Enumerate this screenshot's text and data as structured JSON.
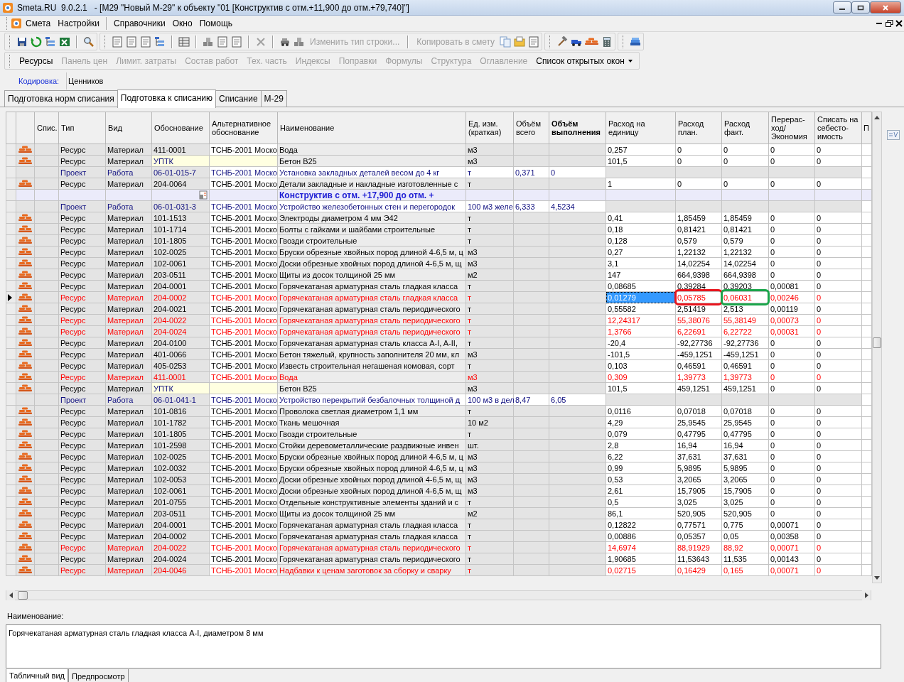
{
  "window": {
    "title": "Smeta.RU  9.0.2.1   - [M29 \"Новый M-29\" к объекту \"01 [Конструктив с отм.+11,900 до отм.+79,740]\"]"
  },
  "menu_groups": [
    [
      "Смета",
      "Настройки"
    ],
    [
      "Справочники",
      "Окно",
      "Помощь"
    ]
  ],
  "toolbar": {
    "buttons": [
      {
        "label": "Изменить тип строки...",
        "disabled": true
      },
      {
        "label": "Копировать в смету",
        "disabled": true
      }
    ]
  },
  "nav_toolbar": [
    {
      "label": "Ресурсы",
      "disabled": false
    },
    {
      "label": "Панель цен",
      "disabled": true
    },
    {
      "label": "Лимит. затраты",
      "disabled": true
    },
    {
      "label": "Состав работ",
      "disabled": true
    },
    {
      "label": "Тех. часть",
      "disabled": true
    },
    {
      "label": "Индексы",
      "disabled": true
    },
    {
      "label": "Поправки",
      "disabled": true
    },
    {
      "label": "Формулы",
      "disabled": true
    },
    {
      "label": "Структура",
      "disabled": true
    },
    {
      "label": "Оглавление",
      "disabled": true
    },
    {
      "label": "Список открытых окон",
      "disabled": false,
      "dropdown": true
    }
  ],
  "coding": {
    "label": "Кодировка:",
    "value": "Ценников"
  },
  "tabs": [
    {
      "label": "Подготовка норм списания",
      "selected": false
    },
    {
      "label": "Подготовка к списанию",
      "selected": true
    },
    {
      "label": "Списание",
      "selected": false
    },
    {
      "label": "М-29",
      "selected": false
    }
  ],
  "table": {
    "columns": [
      {
        "label": "Спис.",
        "bold": false
      },
      {
        "label": "Тип",
        "bold": false
      },
      {
        "label": "Вид",
        "bold": false
      },
      {
        "label": "Обоснование",
        "bold": false
      },
      {
        "label": "Альтернативное обоснование",
        "bold": false
      },
      {
        "label": "Наименование",
        "bold": false
      },
      {
        "label": "Ед. изм. (краткая)",
        "bold": false
      },
      {
        "label": "Объём всего",
        "bold": false
      },
      {
        "label": "Объём выполнения",
        "bold": true
      },
      {
        "label": "Расход на единицу",
        "bold": false
      },
      {
        "label": "Расход план.",
        "bold": false
      },
      {
        "label": "Расход факт.",
        "bold": false
      },
      {
        "label": "Перерас-ход/ Экономия",
        "bold": false
      },
      {
        "label": "Списать на себесто-имость",
        "bold": false
      },
      {
        "label": "П",
        "bold": false
      }
    ],
    "rows": [
      {
        "kind": "resource",
        "warning": false,
        "selected": false,
        "type": "Ресурс",
        "view": "Материал",
        "code": "411-0001",
        "alt": "ТСНБ-2001 Моско",
        "name": "Вода",
        "unit": "м3",
        "per_unit": "0,257",
        "plan": "0",
        "fact": "0",
        "overrun": "0",
        "write_off": "0"
      },
      {
        "kind": "aggregate",
        "warning": false,
        "selected": false,
        "type": "Ресурс",
        "view": "Материал",
        "code": "УПТК",
        "name": "Бетон B25",
        "unit": "м3",
        "per_unit": "101,5",
        "plan": "0",
        "fact": "0",
        "overrun": "0",
        "write_off": "0"
      },
      {
        "kind": "work",
        "warning": false,
        "selected": false,
        "type": "Проект",
        "view": "Работа",
        "code": "06-01-015-7",
        "alt": "ТСНБ-2001 Моско",
        "name": "Установка закладных деталей весом до 4 кг",
        "unit": "т",
        "vol_total": "0,371",
        "vol_done": "0"
      },
      {
        "kind": "resource",
        "warning": false,
        "selected": false,
        "type": "Ресурс",
        "view": "Материал",
        "code": "204-0064",
        "alt": "ТСНБ-2001 Моско",
        "name": "Детали закладные и накладные изготовленные с",
        "unit": "т",
        "per_unit": "1",
        "plan": "0",
        "fact": "0",
        "overrun": "0",
        "write_off": "0"
      },
      {
        "kind": "section",
        "warning": false,
        "selected": false,
        "name": "Конструктив с отм. +17,900 до отм. +"
      },
      {
        "kind": "work",
        "warning": false,
        "selected": false,
        "type": "Проект",
        "view": "Работа",
        "code": "06-01-031-3",
        "alt": "ТСНБ-2001 Моско",
        "name": "Устройство железобетонных стен и перегородок",
        "unit": "100 м3 желе",
        "vol_total": "6,333",
        "vol_done": "4,5234"
      },
      {
        "kind": "resource",
        "warning": false,
        "selected": false,
        "type": "Ресурс",
        "view": "Материал",
        "code": "101-1513",
        "alt": "ТСНБ-2001 Моско",
        "name": "Электроды диаметром 4 мм Э42",
        "unit": "т",
        "per_unit": "0,41",
        "plan": "1,85459",
        "fact": "1,85459",
        "overrun": "0",
        "write_off": "0"
      },
      {
        "kind": "resource",
        "warning": false,
        "selected": false,
        "type": "Ресурс",
        "view": "Материал",
        "code": "101-1714",
        "alt": "ТСНБ-2001 Моско",
        "name": "Болты с гайками и шайбами строительные",
        "unit": "т",
        "per_unit": "0,18",
        "plan": "0,81421",
        "fact": "0,81421",
        "overrun": "0",
        "write_off": "0"
      },
      {
        "kind": "resource",
        "warning": false,
        "selected": false,
        "type": "Ресурс",
        "view": "Материал",
        "code": "101-1805",
        "alt": "ТСНБ-2001 Моско",
        "name": "Гвозди строительные",
        "unit": "т",
        "per_unit": "0,128",
        "plan": "0,579",
        "fact": "0,579",
        "overrun": "0",
        "write_off": "0"
      },
      {
        "kind": "resource",
        "warning": false,
        "selected": false,
        "type": "Ресурс",
        "view": "Материал",
        "code": "102-0025",
        "alt": "ТСНБ-2001 Моско",
        "name": "Бруски обрезные хвойных пород длиной 4-6,5 м, ц",
        "unit": "м3",
        "per_unit": "0,27",
        "plan": "1,22132",
        "fact": "1,22132",
        "overrun": "0",
        "write_off": "0"
      },
      {
        "kind": "resource",
        "warning": false,
        "selected": false,
        "type": "Ресурс",
        "view": "Материал",
        "code": "102-0061",
        "alt": "ТСНБ-2001 Моско",
        "name": "Доски обрезные хвойных пород длиной 4-6,5 м, щ",
        "unit": "м3",
        "per_unit": "3,1",
        "plan": "14,02254",
        "fact": "14,02254",
        "overrun": "0",
        "write_off": "0"
      },
      {
        "kind": "resource",
        "warning": false,
        "selected": false,
        "type": "Ресурс",
        "view": "Материал",
        "code": "203-0511",
        "alt": "ТСНБ-2001 Моско",
        "name": "Щиты из досок толщиной 25 мм",
        "unit": "м2",
        "per_unit": "147",
        "plan": "664,9398",
        "fact": "664,9398",
        "overrun": "0",
        "write_off": "0"
      },
      {
        "kind": "resource",
        "warning": false,
        "selected": false,
        "type": "Ресурс",
        "view": "Материал",
        "code": "204-0001",
        "alt": "ТСНБ-2001 Моско",
        "name": "Горячекатаная арматурная сталь гладкая класса",
        "unit": "т",
        "per_unit": "0,08685",
        "plan": "0,39284",
        "fact": "0,39203",
        "overrun": "0,00081",
        "write_off": "0"
      },
      {
        "kind": "resource",
        "warning": true,
        "selected": true,
        "cell_states": {
          "per_unit": {
            "focused": true
          },
          "plan": {
            "color": "#e8141c"
          },
          "fact": {
            "color": "#1aa54a"
          }
        },
        "type": "Ресурс",
        "view": "Материал",
        "code": "204-0002",
        "alt": "ТСНБ-2001 Моско",
        "name": "Горячекатаная арматурная сталь гладкая класса",
        "unit": "т",
        "per_unit": "0,01279",
        "plan": "0,05785",
        "fact": "0,06031",
        "overrun": "0,00246",
        "write_off": "0"
      },
      {
        "kind": "resource",
        "warning": false,
        "selected": false,
        "type": "Ресурс",
        "view": "Материал",
        "code": "204-0021",
        "alt": "ТСНБ-2001 Моско",
        "name": "Горячекатаная арматурная сталь периодического",
        "unit": "т",
        "per_unit": "0,55582",
        "plan": "2,51419",
        "fact": "2,513",
        "overrun": "0,00119",
        "write_off": "0"
      },
      {
        "kind": "resource",
        "warning": true,
        "selected": false,
        "type": "Ресурс",
        "view": "Материал",
        "code": "204-0022",
        "alt": "ТСНБ-2001 Моско",
        "name": "Горячекатаная арматурная сталь периодического",
        "unit": "т",
        "per_unit": "12,24317",
        "plan": "55,38076",
        "fact": "55,38149",
        "overrun": "0,00073",
        "write_off": "0"
      },
      {
        "kind": "resource",
        "warning": true,
        "selected": false,
        "type": "Ресурс",
        "view": "Материал",
        "code": "204-0024",
        "alt": "ТСНБ-2001 Моско",
        "name": "Горячекатаная арматурная сталь периодического",
        "unit": "т",
        "per_unit": "1,3766",
        "plan": "6,22691",
        "fact": "6,22722",
        "overrun": "0,00031",
        "write_off": "0"
      },
      {
        "kind": "resource",
        "warning": false,
        "selected": false,
        "type": "Ресурс",
        "view": "Материал",
        "code": "204-0100",
        "alt": "ТСНБ-2001 Моско",
        "name": "Горячекатаная арматурная сталь класса A-I, A-II,",
        "unit": "т",
        "per_unit": "-20,4",
        "plan": "-92,27736",
        "fact": "-92,27736",
        "overrun": "0",
        "write_off": "0"
      },
      {
        "kind": "resource",
        "warning": false,
        "selected": false,
        "type": "Ресурс",
        "view": "Материал",
        "code": "401-0066",
        "alt": "ТСНБ-2001 Моско",
        "name": "Бетон тяжелый, крупность заполнителя 20 мм, кл",
        "unit": "м3",
        "per_unit": "-101,5",
        "plan": "-459,1251",
        "fact": "-459,1251",
        "overrun": "0",
        "write_off": "0"
      },
      {
        "kind": "resource",
        "warning": false,
        "selected": false,
        "type": "Ресурс",
        "view": "Материал",
        "code": "405-0253",
        "alt": "ТСНБ-2001 Моско",
        "name": "Известь строительная негашеная комовая, сорт",
        "unit": "т",
        "per_unit": "0,103",
        "plan": "0,46591",
        "fact": "0,46591",
        "overrun": "0",
        "write_off": "0"
      },
      {
        "kind": "resource",
        "warning": true,
        "selected": false,
        "type": "Ресурс",
        "view": "Материал",
        "code": "411-0001",
        "alt": "ТСНБ-2001 Моско",
        "name": "Вода",
        "unit": "м3",
        "per_unit": "0,309",
        "plan": "1,39773",
        "fact": "1,39773",
        "overrun": "0",
        "write_off": "0"
      },
      {
        "kind": "aggregate",
        "warning": false,
        "selected": false,
        "type": "Ресурс",
        "view": "Материал",
        "code": "УПТК",
        "name": "Бетон B25",
        "unit": "м3",
        "per_unit": "101,5",
        "plan": "459,1251",
        "fact": "459,1251",
        "overrun": "0",
        "write_off": "0"
      },
      {
        "kind": "work",
        "warning": false,
        "selected": false,
        "type": "Проект",
        "view": "Работа",
        "code": "06-01-041-1",
        "alt": "ТСНБ-2001 Моско",
        "name": "Устройство перекрытий безбалочных толщиной д",
        "unit": "100 м3 в дел",
        "vol_total": "8,47",
        "vol_done": "6,05"
      },
      {
        "kind": "resource",
        "warning": false,
        "selected": false,
        "type": "Ресурс",
        "view": "Материал",
        "code": "101-0816",
        "alt": "ТСНБ-2001 Моско",
        "name": "Проволока светлая диаметром 1,1 мм",
        "unit": "т",
        "per_unit": "0,0116",
        "plan": "0,07018",
        "fact": "0,07018",
        "overrun": "0",
        "write_off": "0"
      },
      {
        "kind": "resource",
        "warning": false,
        "selected": false,
        "type": "Ресурс",
        "view": "Материал",
        "code": "101-1782",
        "alt": "ТСНБ-2001 Моско",
        "name": "Ткань мешочная",
        "unit": "10 м2",
        "per_unit": "4,29",
        "plan": "25,9545",
        "fact": "25,9545",
        "overrun": "0",
        "write_off": "0"
      },
      {
        "kind": "resource",
        "warning": false,
        "selected": false,
        "type": "Ресурс",
        "view": "Материал",
        "code": "101-1805",
        "alt": "ТСНБ-2001 Моско",
        "name": "Гвозди строительные",
        "unit": "т",
        "per_unit": "0,079",
        "plan": "0,47795",
        "fact": "0,47795",
        "overrun": "0",
        "write_off": "0"
      },
      {
        "kind": "resource",
        "warning": false,
        "selected": false,
        "type": "Ресурс",
        "view": "Материал",
        "code": "101-2598",
        "alt": "ТСНБ-2001 Моско",
        "name": "Стойки деревометаллические раздвижные инвен",
        "unit": "шт.",
        "per_unit": "2,8",
        "plan": "16,94",
        "fact": "16,94",
        "overrun": "0",
        "write_off": "0"
      },
      {
        "kind": "resource",
        "warning": false,
        "selected": false,
        "type": "Ресурс",
        "view": "Материал",
        "code": "102-0025",
        "alt": "ТСНБ-2001 Моско",
        "name": "Бруски обрезные хвойных пород длиной 4-6,5 м, ц",
        "unit": "м3",
        "per_unit": "6,22",
        "plan": "37,631",
        "fact": "37,631",
        "overrun": "0",
        "write_off": "0"
      },
      {
        "kind": "resource",
        "warning": false,
        "selected": false,
        "type": "Ресурс",
        "view": "Материал",
        "code": "102-0032",
        "alt": "ТСНБ-2001 Моско",
        "name": "Бруски обрезные хвойных пород длиной 4-6,5 м, ц",
        "unit": "м3",
        "per_unit": "0,99",
        "plan": "5,9895",
        "fact": "5,9895",
        "overrun": "0",
        "write_off": "0"
      },
      {
        "kind": "resource",
        "warning": false,
        "selected": false,
        "type": "Ресурс",
        "view": "Материал",
        "code": "102-0053",
        "alt": "ТСНБ-2001 Моско",
        "name": "Доски обрезные хвойных пород длиной 4-6,5 м, щ",
        "unit": "м3",
        "per_unit": "0,53",
        "plan": "3,2065",
        "fact": "3,2065",
        "overrun": "0",
        "write_off": "0"
      },
      {
        "kind": "resource",
        "warning": false,
        "selected": false,
        "type": "Ресурс",
        "view": "Материал",
        "code": "102-0061",
        "alt": "ТСНБ-2001 Моско",
        "name": "Доски обрезные хвойных пород длиной 4-6,5 м, щ",
        "unit": "м3",
        "per_unit": "2,61",
        "plan": "15,7905",
        "fact": "15,7905",
        "overrun": "0",
        "write_off": "0"
      },
      {
        "kind": "resource",
        "warning": false,
        "selected": false,
        "type": "Ресурс",
        "view": "Материал",
        "code": "201-0755",
        "alt": "ТСНБ-2001 Моско",
        "name": "Отдельные конструктивные элементы зданий и с",
        "unit": "т",
        "per_unit": "0,5",
        "plan": "3,025",
        "fact": "3,025",
        "overrun": "0",
        "write_off": "0"
      },
      {
        "kind": "resource",
        "warning": false,
        "selected": false,
        "type": "Ресурс",
        "view": "Материал",
        "code": "203-0511",
        "alt": "ТСНБ-2001 Моско",
        "name": "Щиты из досок толщиной 25 мм",
        "unit": "м2",
        "per_unit": "86,1",
        "plan": "520,905",
        "fact": "520,905",
        "overrun": "0",
        "write_off": "0"
      },
      {
        "kind": "resource",
        "warning": false,
        "selected": false,
        "type": "Ресурс",
        "view": "Материал",
        "code": "204-0001",
        "alt": "ТСНБ-2001 Моско",
        "name": "Горячекатаная арматурная сталь гладкая класса",
        "unit": "т",
        "per_unit": "0,12822",
        "plan": "0,77571",
        "fact": "0,775",
        "overrun": "0,00071",
        "write_off": "0"
      },
      {
        "kind": "resource",
        "warning": false,
        "selected": false,
        "type": "Ресурс",
        "view": "Материал",
        "code": "204-0002",
        "alt": "ТСНБ-2001 Моско",
        "name": "Горячекатаная арматурная сталь гладкая класса",
        "unit": "т",
        "per_unit": "0,00886",
        "plan": "0,05357",
        "fact": "0,05",
        "overrun": "0,00358",
        "write_off": "0"
      },
      {
        "kind": "resource",
        "warning": true,
        "selected": false,
        "type": "Ресурс",
        "view": "Материал",
        "code": "204-0022",
        "alt": "ТСНБ-2001 Моско",
        "name": "Горячекатаная арматурная сталь периодического",
        "unit": "т",
        "per_unit": "14,6974",
        "plan": "88,91929",
        "fact": "88,92",
        "overrun": "0,00071",
        "write_off": "0"
      },
      {
        "kind": "resource",
        "warning": false,
        "selected": false,
        "type": "Ресурс",
        "view": "Материал",
        "code": "204-0024",
        "alt": "ТСНБ-2001 Моско",
        "name": "Горячекатаная арматурная сталь периодического",
        "unit": "т",
        "per_unit": "1,90685",
        "plan": "11,53643",
        "fact": "11,535",
        "overrun": "0,00143",
        "write_off": "0"
      },
      {
        "kind": "resource",
        "warning": true,
        "selected": false,
        "type": "Ресурс",
        "view": "Материал",
        "code": "204-0046",
        "alt": "ТСНБ-2001 Моско",
        "name": "Надбавки к ценам заготовок за сборку и сварку",
        "unit": "т",
        "per_unit": "0,02715",
        "plan": "0,16429",
        "fact": "0,165",
        "overrun": "0,00071",
        "write_off": "0"
      }
    ]
  },
  "details": {
    "label": "Наименование:",
    "value": "Горячекатаная арматурная сталь гладкая класса A-I, диаметром 8 мм"
  },
  "bottom_tabs": [
    {
      "label": "Табличный вид",
      "selected": true
    },
    {
      "label": "Предпросмотр",
      "selected": false
    }
  ]
}
